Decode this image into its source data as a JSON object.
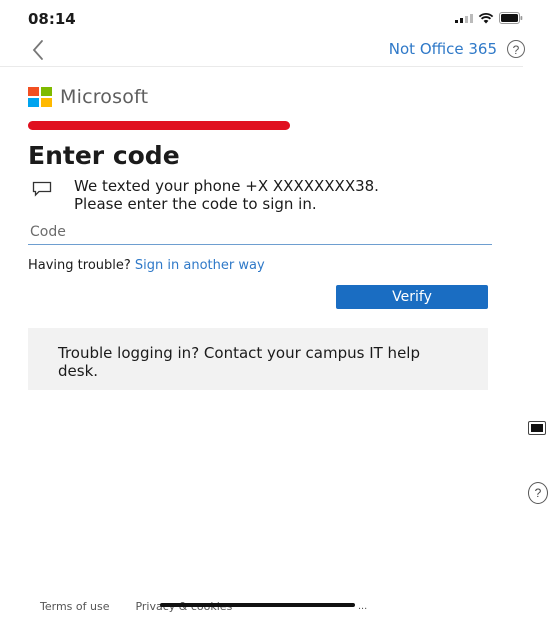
{
  "status_bar": {
    "time": "08:14"
  },
  "nav": {
    "link_label": "Not Office 365",
    "help_label": "?"
  },
  "brand": {
    "name": "Microsoft",
    "colors": [
      "#f25022",
      "#7fba00",
      "#00a4ef",
      "#ffb900"
    ]
  },
  "redaction_color": "#e0101f",
  "page": {
    "title": "Enter code",
    "description_line1": "We texted your phone +X XXXXXXXX38.",
    "description_line2": "Please enter the code to sign in.",
    "code_placeholder": "Code",
    "code_value": "",
    "trouble_text": "Having trouble?",
    "trouble_link": "Sign in another way",
    "verify_label": "Verify",
    "info_text": "Trouble logging in? Contact your campus IT help desk."
  },
  "side": {
    "help_label": "?"
  },
  "footer": {
    "terms": "Terms of use",
    "privacy": "Privacy & cookies",
    "more": "..."
  },
  "icons": {
    "back": "chevron-left-icon",
    "help": "help-circle-icon",
    "sms": "chat-bubble-icon",
    "signal": "signal-icon",
    "wifi": "wifi-icon",
    "battery": "battery-icon"
  }
}
